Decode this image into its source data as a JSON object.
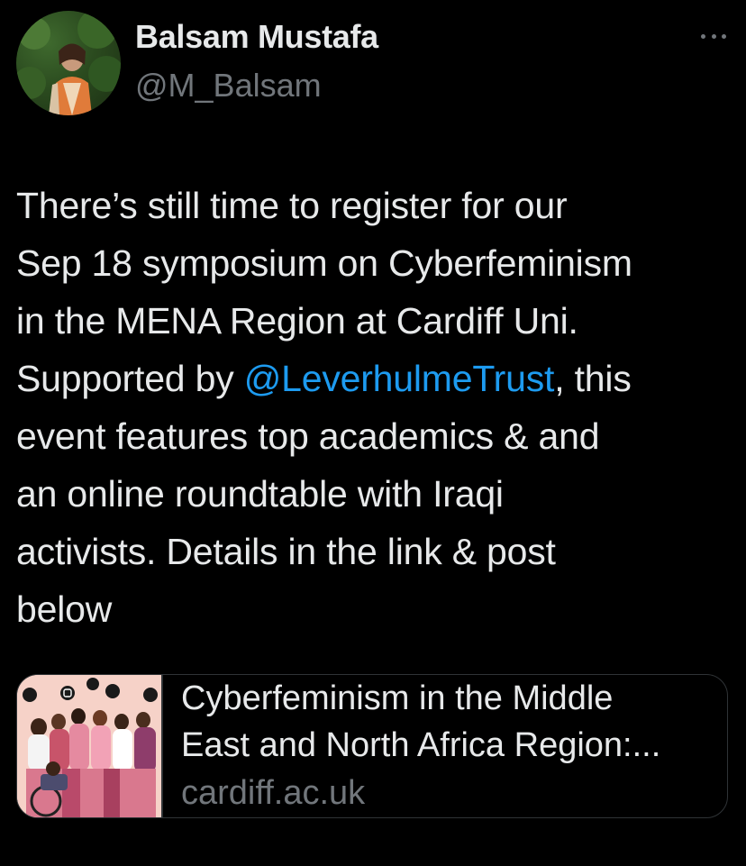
{
  "author": {
    "display_name": "Balsam Mustafa",
    "handle": "@M_Balsam"
  },
  "more_icon": "more-dots-icon",
  "tweet": {
    "lines": [
      {
        "text": "There’s still time to register for our"
      },
      {
        "text": "Sep 18 symposium on Cyberfeminism"
      },
      {
        "text": "in the MENA Region at Cardiff Uni."
      },
      {
        "pre": "Supported by ",
        "mention": "@LeverhulmeTrust",
        "post": ", this"
      },
      {
        "text": "event features top academics & and"
      },
      {
        "text": "an online roundtable with Iraqi"
      },
      {
        "text": "activists. Details in the link & post"
      },
      {
        "text": "below"
      }
    ]
  },
  "link_card": {
    "title_line_1": "Cyberfeminism in the Middle",
    "title_line_2": "East and North Africa Region:...",
    "domain": "cardiff.ac.uk"
  },
  "colors": {
    "background": "#000000",
    "text": "#e7e9ea",
    "secondary": "#71767b",
    "link": "#1d9bf0",
    "border": "#2f3336"
  }
}
